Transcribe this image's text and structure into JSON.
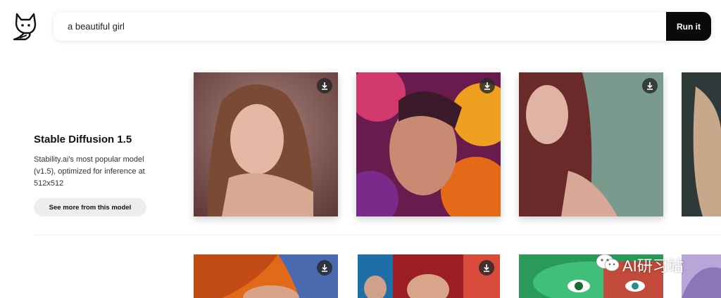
{
  "search": {
    "value": "a beautiful girl",
    "run_label": "Run it"
  },
  "model": {
    "title": "Stable Diffusion 1.5",
    "description": "Stability.ai's most popular model (v1.5), optimized for inference at 512x512",
    "see_more_label": "See more from this model"
  },
  "watermark": {
    "text": "AI研习站"
  },
  "icons": {
    "logo": "cat-logo-icon",
    "download": "download-icon",
    "watermark": "wechat-icon"
  }
}
